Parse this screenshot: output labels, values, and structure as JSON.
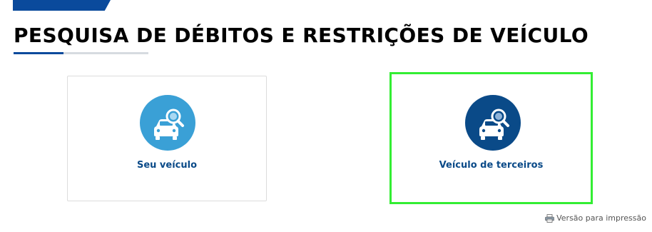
{
  "header": {
    "title": "PESQUISA DE DÉBITOS E RESTRIÇÕES DE VEÍCULO"
  },
  "options": [
    {
      "label": "Seu veículo",
      "icon": "car-search-icon",
      "color": "#3aa0d6"
    },
    {
      "label": "Veículo de terceiros",
      "icon": "car-search-icon",
      "color": "#0a4a88"
    }
  ],
  "footer": {
    "print_label": "Versão para impressão",
    "print_icon": "printer-icon"
  },
  "colors": {
    "brand_blue": "#0a4a9c",
    "selected_outline": "#33ee33"
  }
}
